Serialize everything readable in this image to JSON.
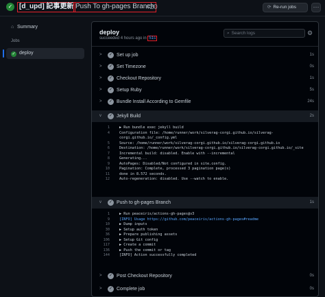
{
  "header": {
    "title_tag": "[d_upd] 記事更新",
    "title_workflow": "Push To gh-pages Branch",
    "run_number": "#20",
    "rerun_label": "Re-run jobs",
    "status_icon": "check-circle-icon",
    "rerun_icon": "sync-icon",
    "menu_icon": "kebab-horizontal-icon"
  },
  "sidebar": {
    "summary_label": "Summary",
    "summary_icon": "home-icon",
    "jobs_label": "Jobs",
    "job_label": "deploy",
    "job_icon": "check-circle-icon"
  },
  "panel": {
    "title": "deploy",
    "subtitle_prefix": "succeeded 4 hours ago in",
    "duration": "51s",
    "search_placeholder": "Search logs",
    "search_icon": "search-icon",
    "settings_icon": "gear-icon"
  },
  "steps": [
    {
      "name": "Set up job",
      "time": "1s",
      "expanded": false
    },
    {
      "name": "Set Timezone",
      "time": "0s",
      "expanded": false
    },
    {
      "name": "Checkout Repository",
      "time": "1s",
      "expanded": false
    },
    {
      "name": "Setup Ruby",
      "time": "5s",
      "expanded": false
    },
    {
      "name": "Bundle Install According to Gemfile",
      "time": "24s",
      "expanded": false
    },
    {
      "name": "Jekyll Build",
      "time": "2s",
      "expanded": true
    },
    {
      "name": "Push to gh-pages Branch",
      "time": "1s",
      "expanded": true
    },
    {
      "name": "Post Checkout Repository",
      "time": "0s",
      "expanded": false
    },
    {
      "name": "Complete job",
      "time": "0s",
      "expanded": false
    }
  ],
  "jekyll_log": [
    {
      "n": "1",
      "t": "▶ Run bundle exec jekyll build"
    },
    {
      "n": "4",
      "t": "Configuration file: /home/runner/work/silverag-corgi.github.io/silverag-"
    },
    {
      "n": "",
      "t": "corgi.github.io/_config.yml"
    },
    {
      "n": "5",
      "t": "            Source: /home/runner/work/silverag-corgi.github.io/silverag-corgi.github.io"
    },
    {
      "n": "6",
      "t": "       Destination: /home/runner/work/silverag-corgi.github.io/silverag-corgi.github.io/_site"
    },
    {
      "n": "7",
      "t": " Incremental build: disabled. Enable with --incremental"
    },
    {
      "n": "8",
      "t": "      Generating..."
    },
    {
      "n": "9",
      "t": "       AutoPages: Disabled/Not configured in site.config."
    },
    {
      "n": "10",
      "t": "      Pagination: Complete, processed 3 pagination page(s)"
    },
    {
      "n": "11",
      "t": "                  done in 8.572 seconds."
    },
    {
      "n": "12",
      "t": " Auto-regeneration: disabled. Use --watch to enable."
    }
  ],
  "push_log": [
    {
      "n": "1",
      "t": "▶ Run peaceiris/actions-gh-pages@v3",
      "link": false
    },
    {
      "n": "9",
      "t": "[INFO] Usage https://github.com/peaceiris/actions-gh-pages#readme",
      "link": true
    },
    {
      "n": "10",
      "t": "▶ Dump inputs",
      "link": false
    },
    {
      "n": "30",
      "t": "▶ Setup auth token",
      "link": false
    },
    {
      "n": "36",
      "t": "▶ Prepare publishing assets",
      "link": false
    },
    {
      "n": "106",
      "t": "▶ Setup Git config",
      "link": false
    },
    {
      "n": "117",
      "t": "▶ Create a commit",
      "link": false
    },
    {
      "n": "136",
      "t": "▶ Push the commit or tag",
      "link": false
    },
    {
      "n": "144",
      "t": "[INFO] Action successfully completed",
      "link": false
    }
  ],
  "colors": {
    "background": "#0d1117",
    "success": "#238636",
    "highlight_box": "#e5202a",
    "link": "#58a6ff"
  }
}
